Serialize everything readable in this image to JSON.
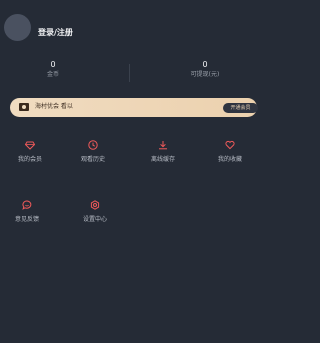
{
  "header": {
    "login_label": "登录/注册"
  },
  "stats": [
    {
      "value": "0",
      "label": "金币"
    },
    {
      "value": "0",
      "label": "可提现(元)"
    }
  ],
  "vip": {
    "text": "海村优会 看以",
    "button": "开通会员"
  },
  "grid": [
    {
      "icon": "gem-icon",
      "label": "我的会员"
    },
    {
      "icon": "clock-icon",
      "label": "观看历史"
    },
    {
      "icon": "download-icon",
      "label": "离线缓存"
    },
    {
      "icon": "heart-icon",
      "label": "我的收藏"
    },
    {
      "icon": "chat-icon",
      "label": "意见反馈"
    },
    {
      "icon": "gear-icon",
      "label": "设置中心"
    }
  ],
  "colors": {
    "accent": "#f05a5a",
    "background": "#252b36",
    "vip_gold": "#f0dcc1"
  }
}
